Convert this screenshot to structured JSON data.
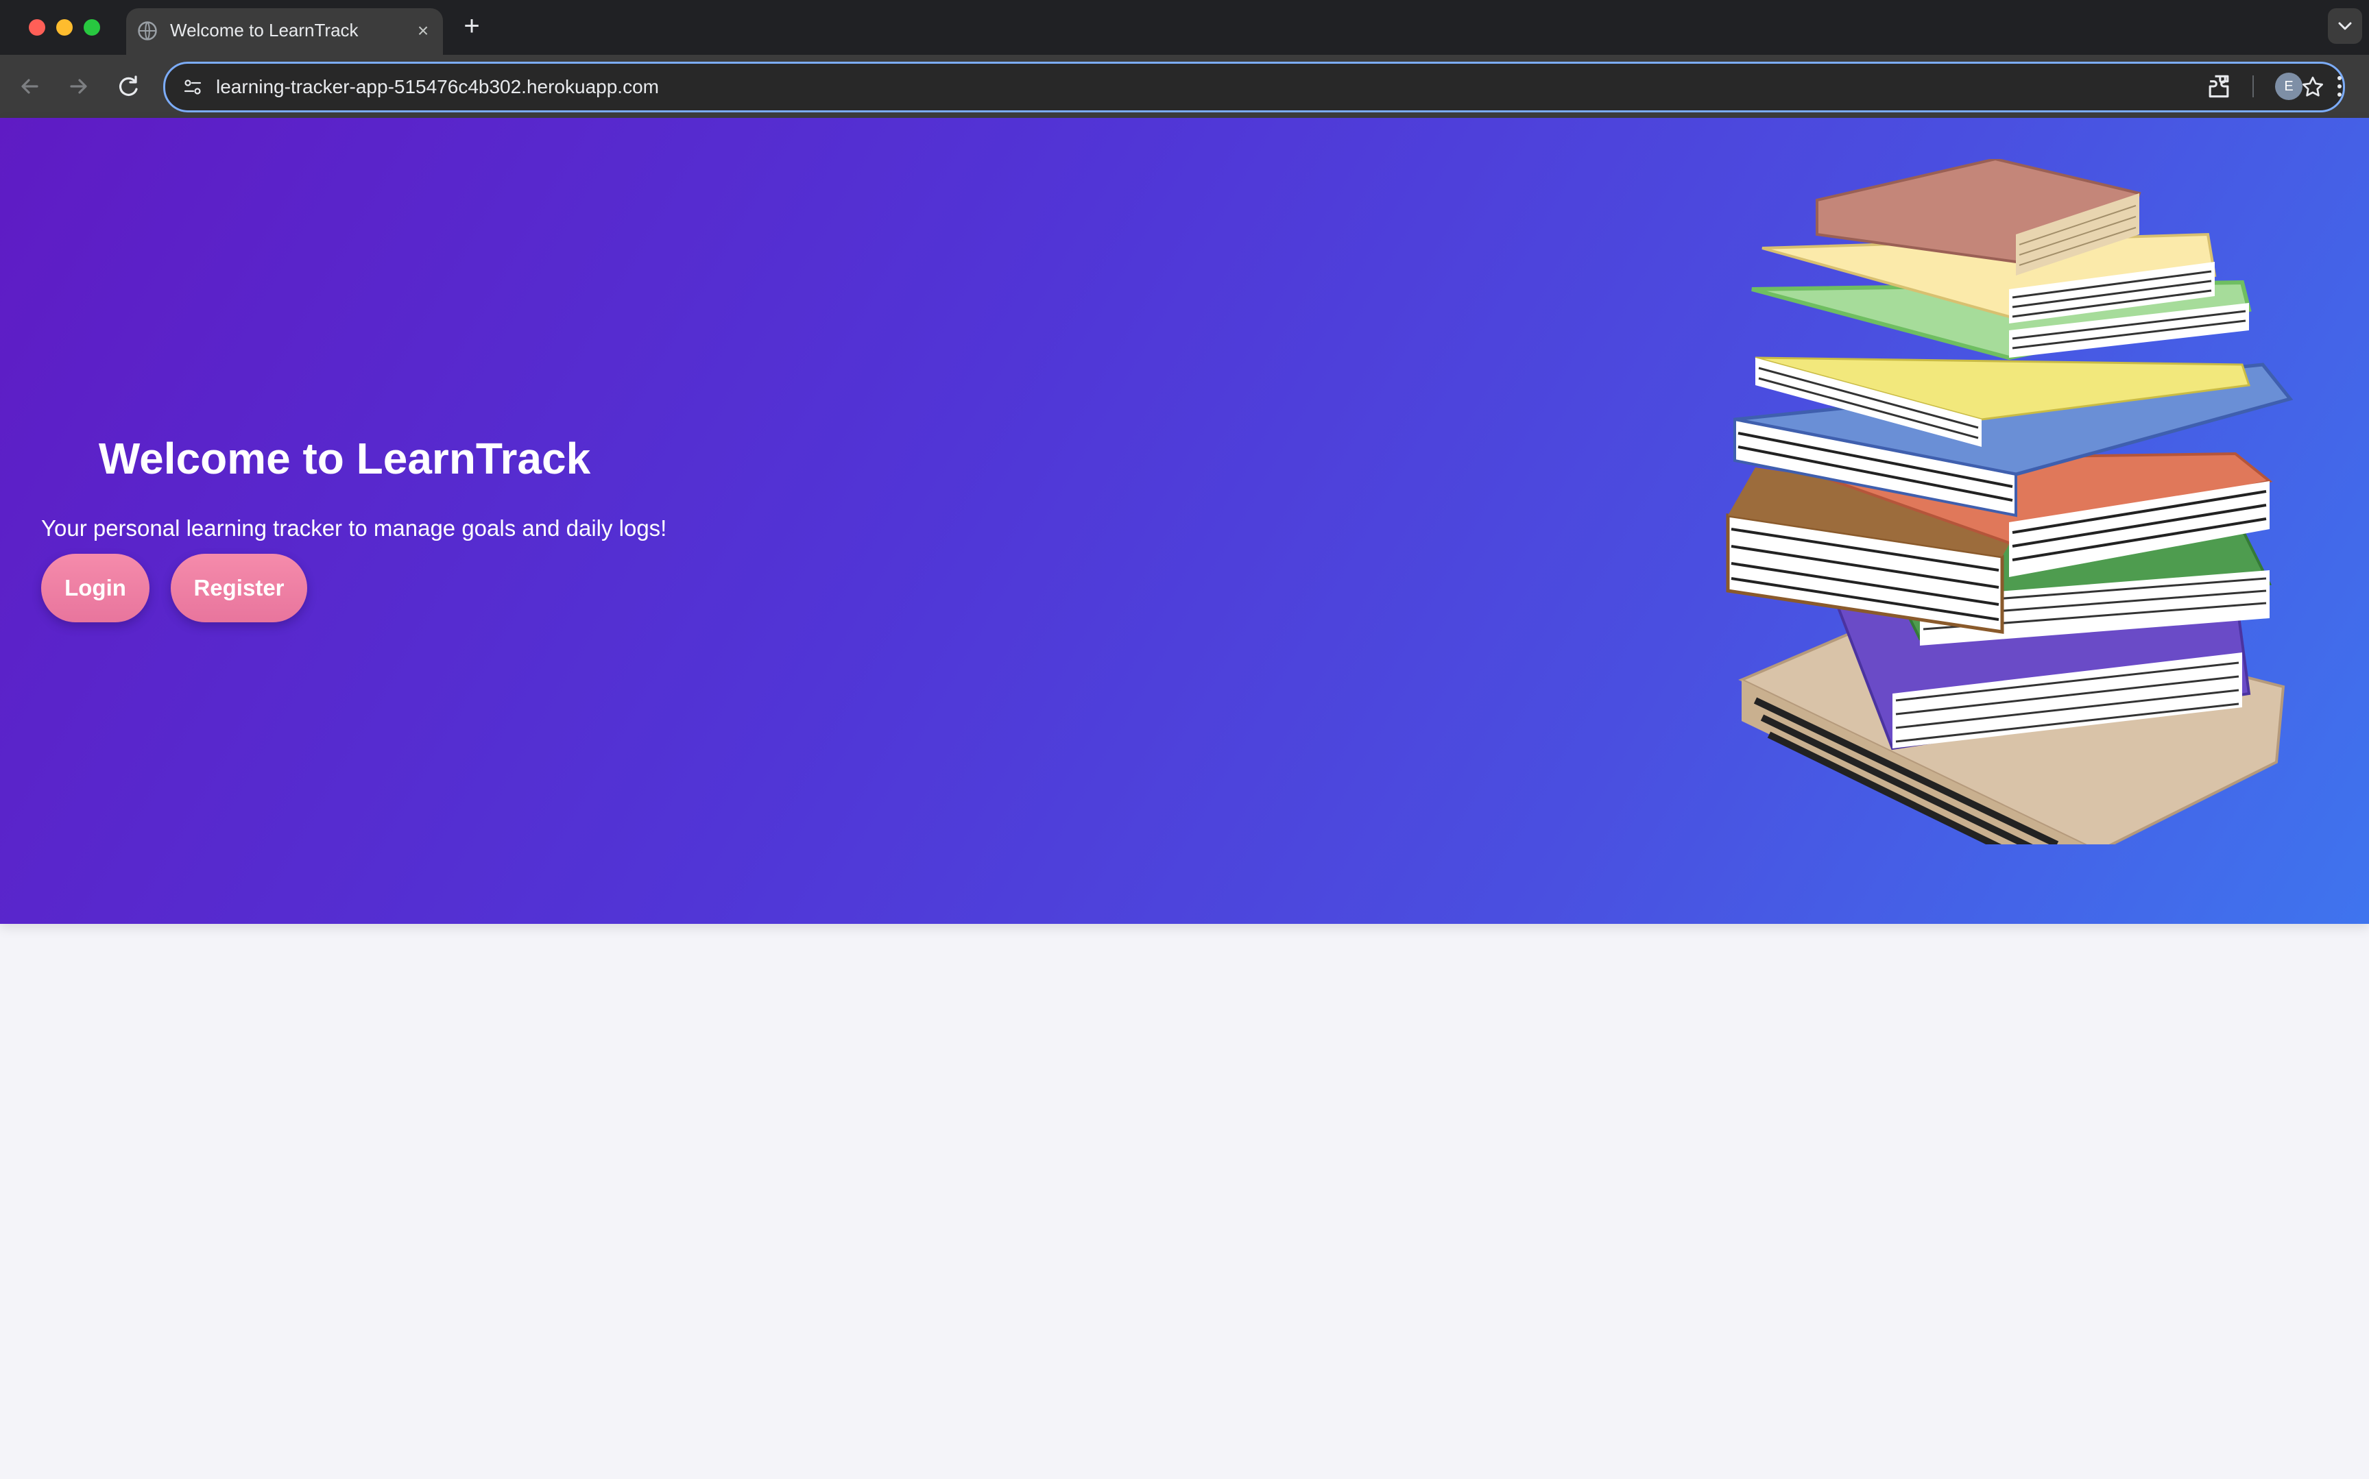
{
  "browser": {
    "tab": {
      "title": "Welcome to LearnTrack",
      "favicon": "globe-icon"
    },
    "address_bar": {
      "url": "learning-tracker-app-515476c4b302.herokuapp.com"
    },
    "profile_initial": "E",
    "icons": [
      "back-arrow-icon",
      "forward-arrow-icon",
      "reload-icon",
      "site-info-icon",
      "bookmark-star-icon",
      "extensions-icon",
      "kebab-menu-icon",
      "chevron-down-icon",
      "close-icon",
      "plus-icon"
    ]
  },
  "hero": {
    "title": "Welcome to LearnTrack",
    "subtitle": "Your personal learning tracker to manage goals and daily logs!",
    "buttons": {
      "login": "Login",
      "register": "Register"
    },
    "illustration": "stack-of-books",
    "gradient": [
      "#5f1bc4",
      "#3f74ee"
    ],
    "button_color": "#ee7fa4"
  },
  "page": {
    "background": "#f4f4f9"
  }
}
